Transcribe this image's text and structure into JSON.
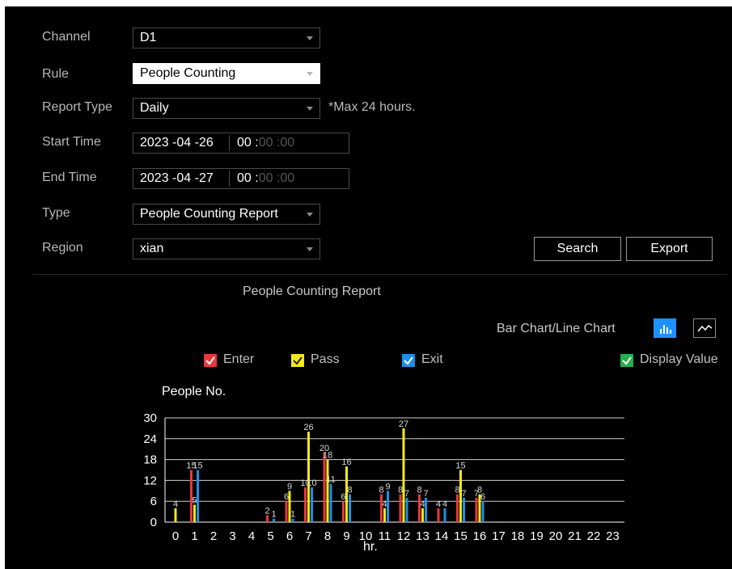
{
  "form": {
    "channel": {
      "label": "Channel",
      "value": "D1"
    },
    "rule": {
      "label": "Rule",
      "value": "People Counting"
    },
    "report_type": {
      "label": "Report Type",
      "value": "Daily",
      "hint": "*Max 24 hours."
    },
    "start_time": {
      "label": "Start Time",
      "date": "2023 -04 -26",
      "hour": "00 :",
      "rest": "00 :00"
    },
    "end_time": {
      "label": "End Time",
      "date": "2023 -04 -27",
      "hour": "00 :",
      "rest": "00 :00"
    },
    "type": {
      "label": "Type",
      "value": "People Counting Report"
    },
    "region": {
      "label": "Region",
      "value": "xian"
    }
  },
  "buttons": {
    "search": "Search",
    "export": "Export"
  },
  "report": {
    "title": "People Counting Report",
    "mode_label": "Bar Chart/Line Chart",
    "legend": {
      "enter": "Enter",
      "pass": "Pass",
      "exit": "Exit",
      "display_value": "Display Value"
    }
  },
  "colors": {
    "enter": "#e8383d",
    "pass": "#f5e81c",
    "exit": "#1e8fe8",
    "display_value": "#22b24c",
    "background": "#000000"
  },
  "chart_data": {
    "type": "bar",
    "ylabel": "People No.",
    "xlabel": "hr.",
    "ylim": [
      0,
      30
    ],
    "yticks": [
      0,
      6,
      12,
      18,
      24,
      30
    ],
    "categories": [
      "0",
      "1",
      "2",
      "3",
      "4",
      "5",
      "6",
      "7",
      "8",
      "9",
      "10",
      "11",
      "12",
      "13",
      "14",
      "15",
      "16",
      "17",
      "18",
      "19",
      "20",
      "21",
      "22",
      "23"
    ],
    "series": [
      {
        "name": "Enter",
        "values": [
          0,
          15,
          0,
          0,
          0,
          2,
          6,
          10,
          20,
          6,
          0,
          8,
          8,
          8,
          4,
          8,
          7,
          0,
          0,
          0,
          0,
          0,
          0,
          0
        ]
      },
      {
        "name": "Pass",
        "values": [
          4,
          5,
          0,
          0,
          0,
          0,
          9,
          26,
          18,
          16,
          0,
          4,
          27,
          4,
          0,
          15,
          8,
          0,
          0,
          0,
          0,
          0,
          0,
          0
        ]
      },
      {
        "name": "Exit",
        "values": [
          0,
          15,
          0,
          0,
          0,
          1,
          1,
          10,
          11,
          8,
          0,
          9,
          7,
          7,
          4,
          7,
          6,
          0,
          0,
          0,
          0,
          0,
          0,
          0
        ]
      }
    ]
  }
}
